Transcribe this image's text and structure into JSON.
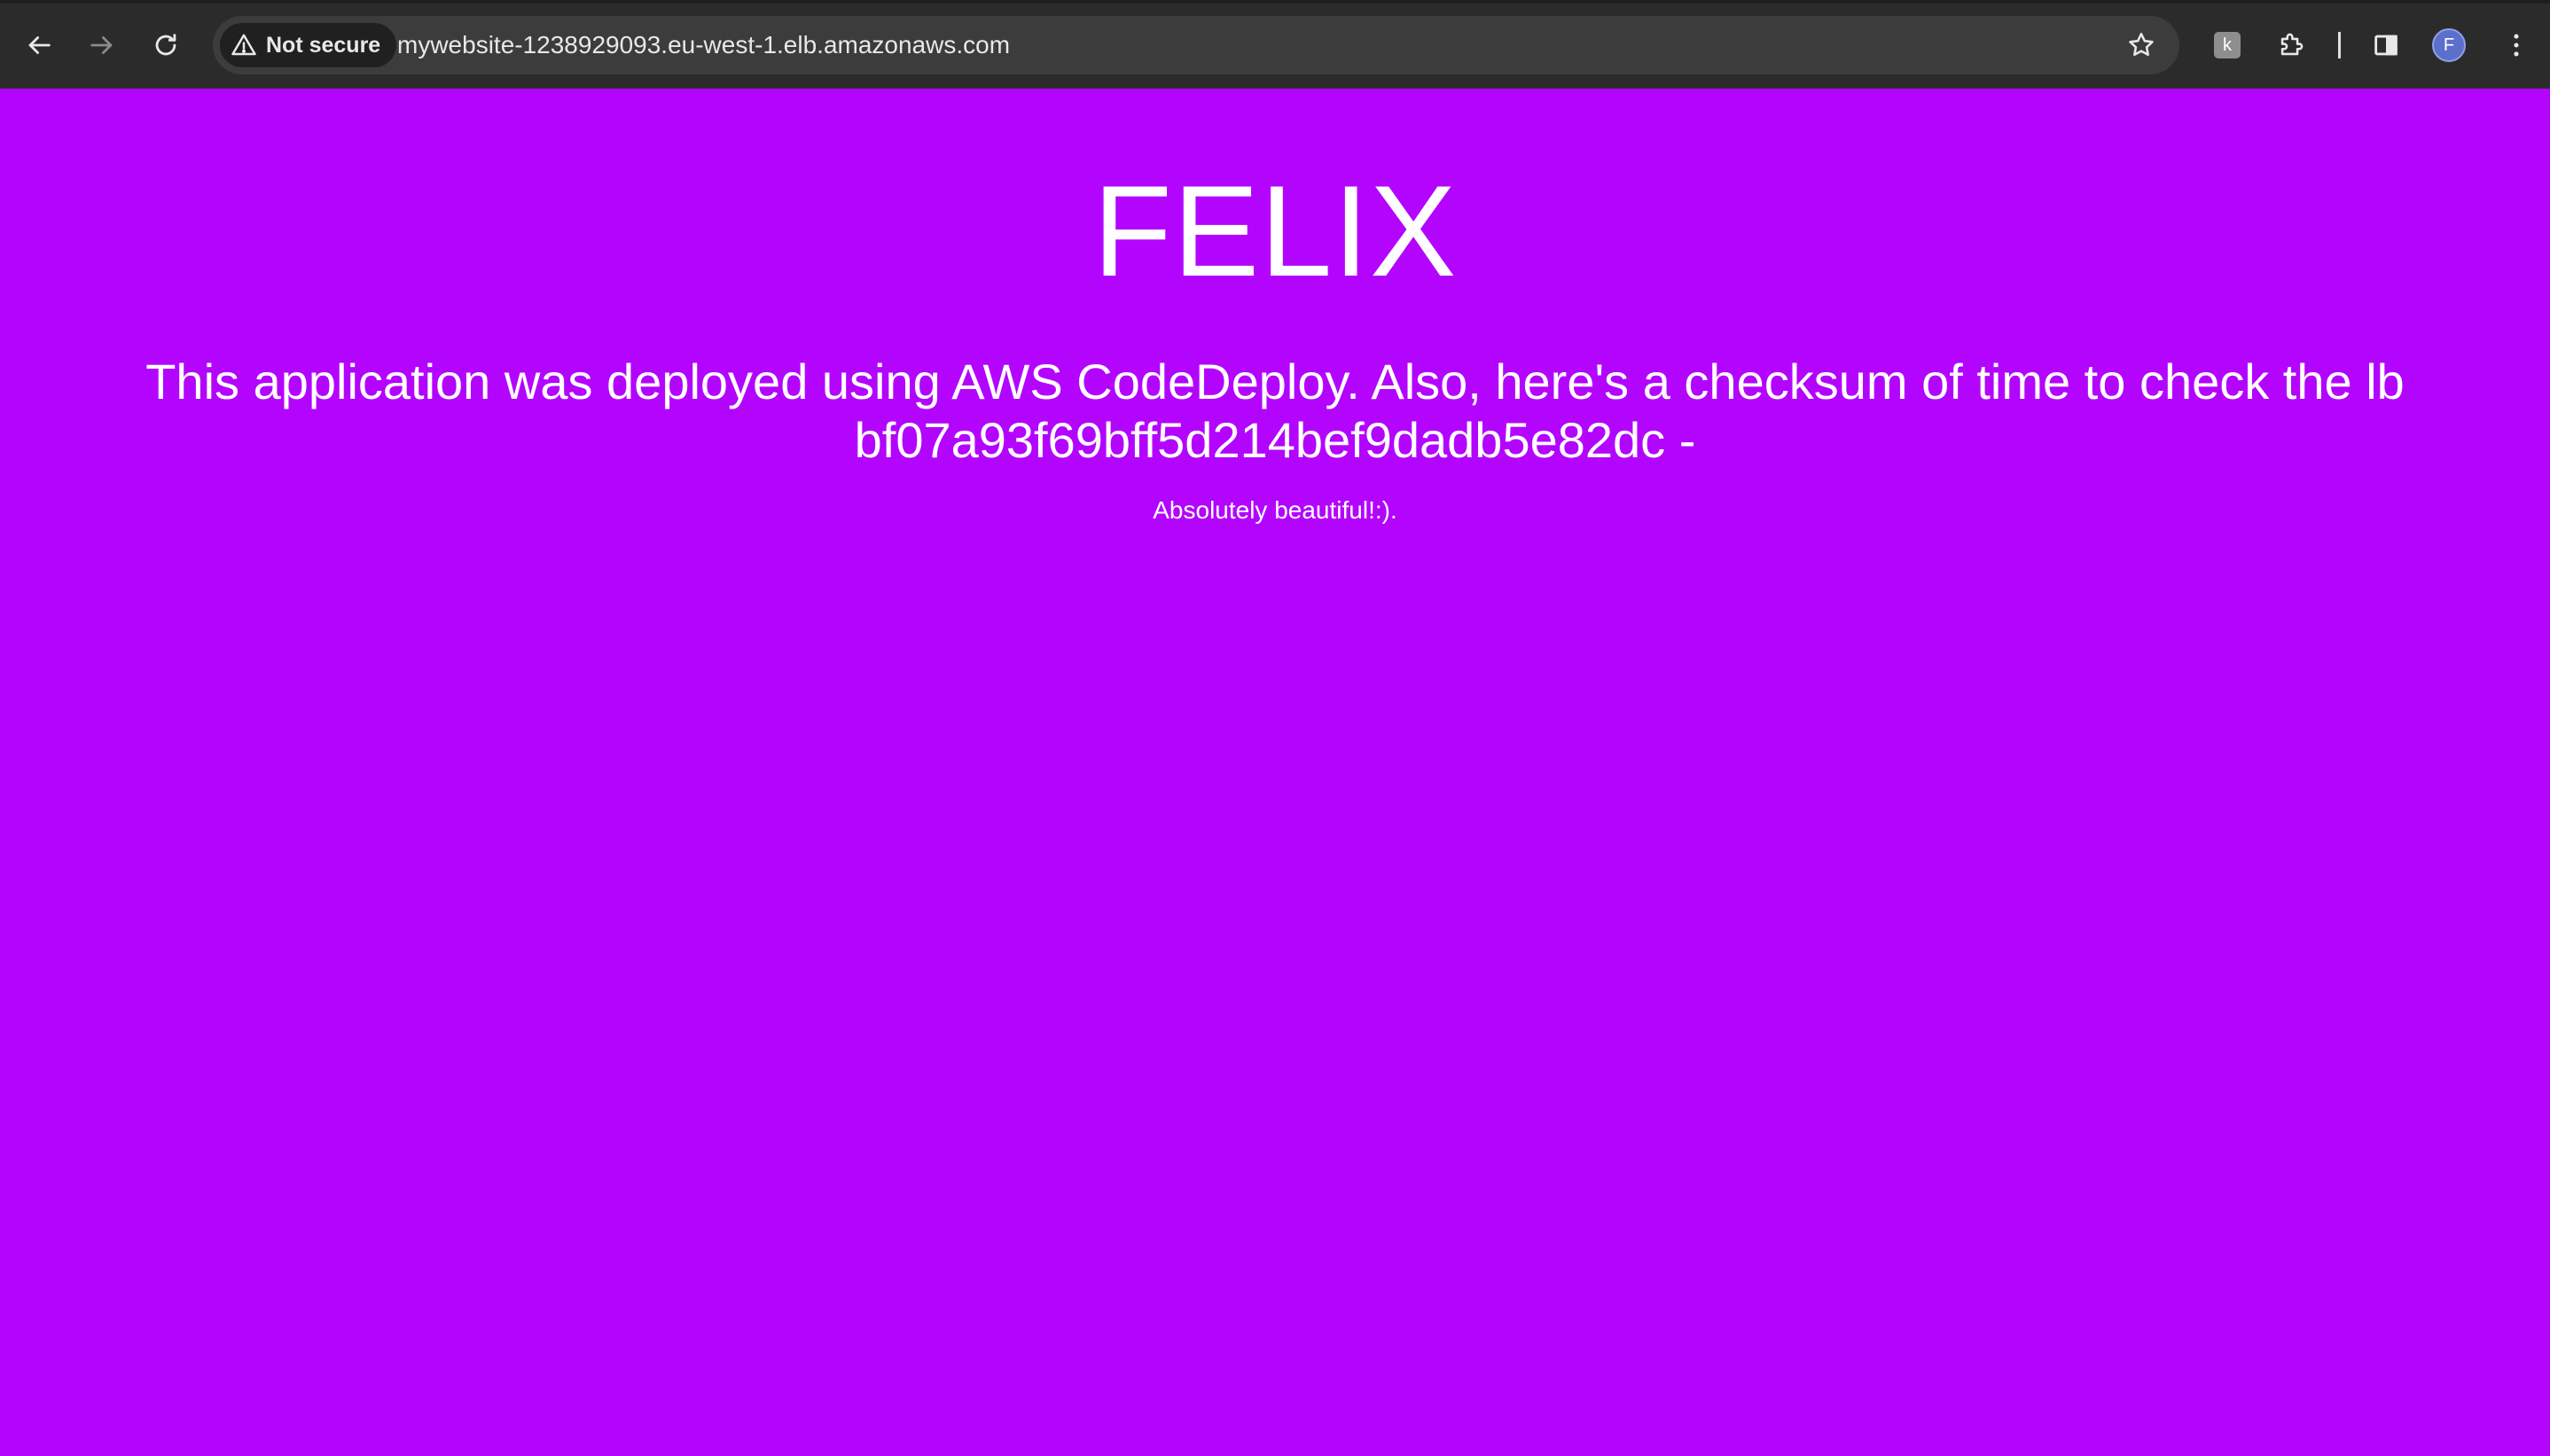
{
  "browser": {
    "security_label": "Not secure",
    "url": "mywebsite-1238929093.eu-west-1.elb.amazonaws.com",
    "avatar_letter": "F",
    "extension_letter": "k",
    "colors": {
      "toolbar": "#2b2b2b",
      "omnibox": "#3c3c3c",
      "avatar": "#5b6fcb"
    },
    "icons": [
      "back-arrow-icon",
      "forward-arrow-icon",
      "reload-icon",
      "warning-icon",
      "star-icon",
      "extension-icon",
      "puzzle-icon",
      "side-panel-icon",
      "avatar",
      "kebab-menu-icon"
    ]
  },
  "page": {
    "background_color": "#b305fe",
    "title": "FELIX",
    "message_line1": "This application was deployed using AWS CodeDeploy. Also, here's a checksum of time to check the lb",
    "message_line2": "bf07a93f69bff5d214bef9dadb5e82dc -",
    "sub_message": "Absolutely beautiful!:)."
  }
}
